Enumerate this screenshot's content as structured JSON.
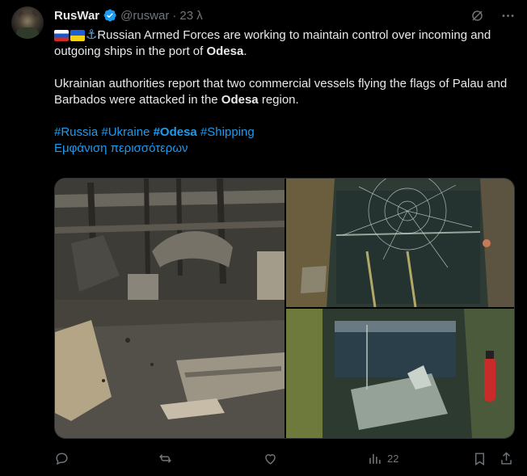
{
  "author": {
    "name": "RusWar",
    "handle": "@ruswar",
    "separator": "·",
    "time": "23 λ"
  },
  "post": {
    "line1_pre": "Russian Armed Forces are working to maintain control over incoming and outgoing ships in the port of ",
    "line1_bold": "Odesa",
    "line1_post": ".",
    "line2_pre": "Ukrainian authorities report that two commercial vessels flying the flags of Palau and Barbados were attacked in the ",
    "line2_bold": "Odesa",
    "line2_post": " region.",
    "hashtags": [
      "#Russia",
      "#Ukraine",
      "#Odesa",
      "#Shipping"
    ],
    "show_more": "Εμφάνιση περισσότερων"
  },
  "icons": {
    "verified": "verified-badge-icon",
    "grok": "grok-icon",
    "more": "more-icon",
    "flags": [
      "russia-flag-icon",
      "ukraine-flag-icon",
      "anchor-icon"
    ]
  },
  "media": [
    {
      "name": "damaged-warehouse-photo"
    },
    {
      "name": "cracked-bridge-window-photo"
    },
    {
      "name": "damaged-crane-cabin-photo"
    }
  ],
  "actions": {
    "views": "22"
  },
  "colors": {
    "background": "#000000",
    "text": "#e7e9ea",
    "muted": "#71767b",
    "link": "#1d9bf0",
    "verified": "#1d9bf0"
  }
}
